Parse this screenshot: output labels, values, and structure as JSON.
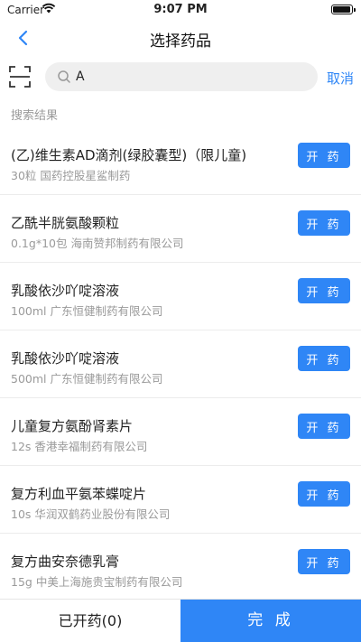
{
  "status_bar": {
    "carrier": "Carrier",
    "time": "9:07 PM"
  },
  "nav": {
    "title": "选择药品",
    "back_icon": "chevron-left-icon"
  },
  "search": {
    "value": "A",
    "placeholder": "",
    "cancel_label": "取消",
    "scan_icon": "scan-icon"
  },
  "section_label": "搜索结果",
  "results": [
    {
      "name": "(乙)维生素AD滴剂(绿胶囊型)（限儿童)",
      "meta": "30粒 国药控股星鲨制药",
      "action": "开 药"
    },
    {
      "name": "乙酰半胱氨酸颗粒",
      "meta": "0.1g*10包 海南赞邦制药有限公司",
      "action": "开 药"
    },
    {
      "name": "乳酸依沙吖啶溶液",
      "meta": "100ml 广东恒健制药有限公司",
      "action": "开 药"
    },
    {
      "name": "乳酸依沙吖啶溶液",
      "meta": "500ml 广东恒健制药有限公司",
      "action": "开 药"
    },
    {
      "name": "儿童复方氨酚肾素片",
      "meta": "12s 香港幸福制药有限公司",
      "action": "开 药"
    },
    {
      "name": "复方利血平氨苯蝶啶片",
      "meta": "10s 华润双鹤药业股份有限公司",
      "action": "开 药"
    },
    {
      "name": "复方曲安奈德乳膏",
      "meta": "15g 中美上海施贵宝制药有限公司",
      "action": "开 药"
    }
  ],
  "bottom": {
    "prescribed_label": "已开药(0)",
    "done_label": "完 成"
  },
  "colors": {
    "accent": "#2f86f6",
    "muted_text": "#9a9a9a"
  }
}
